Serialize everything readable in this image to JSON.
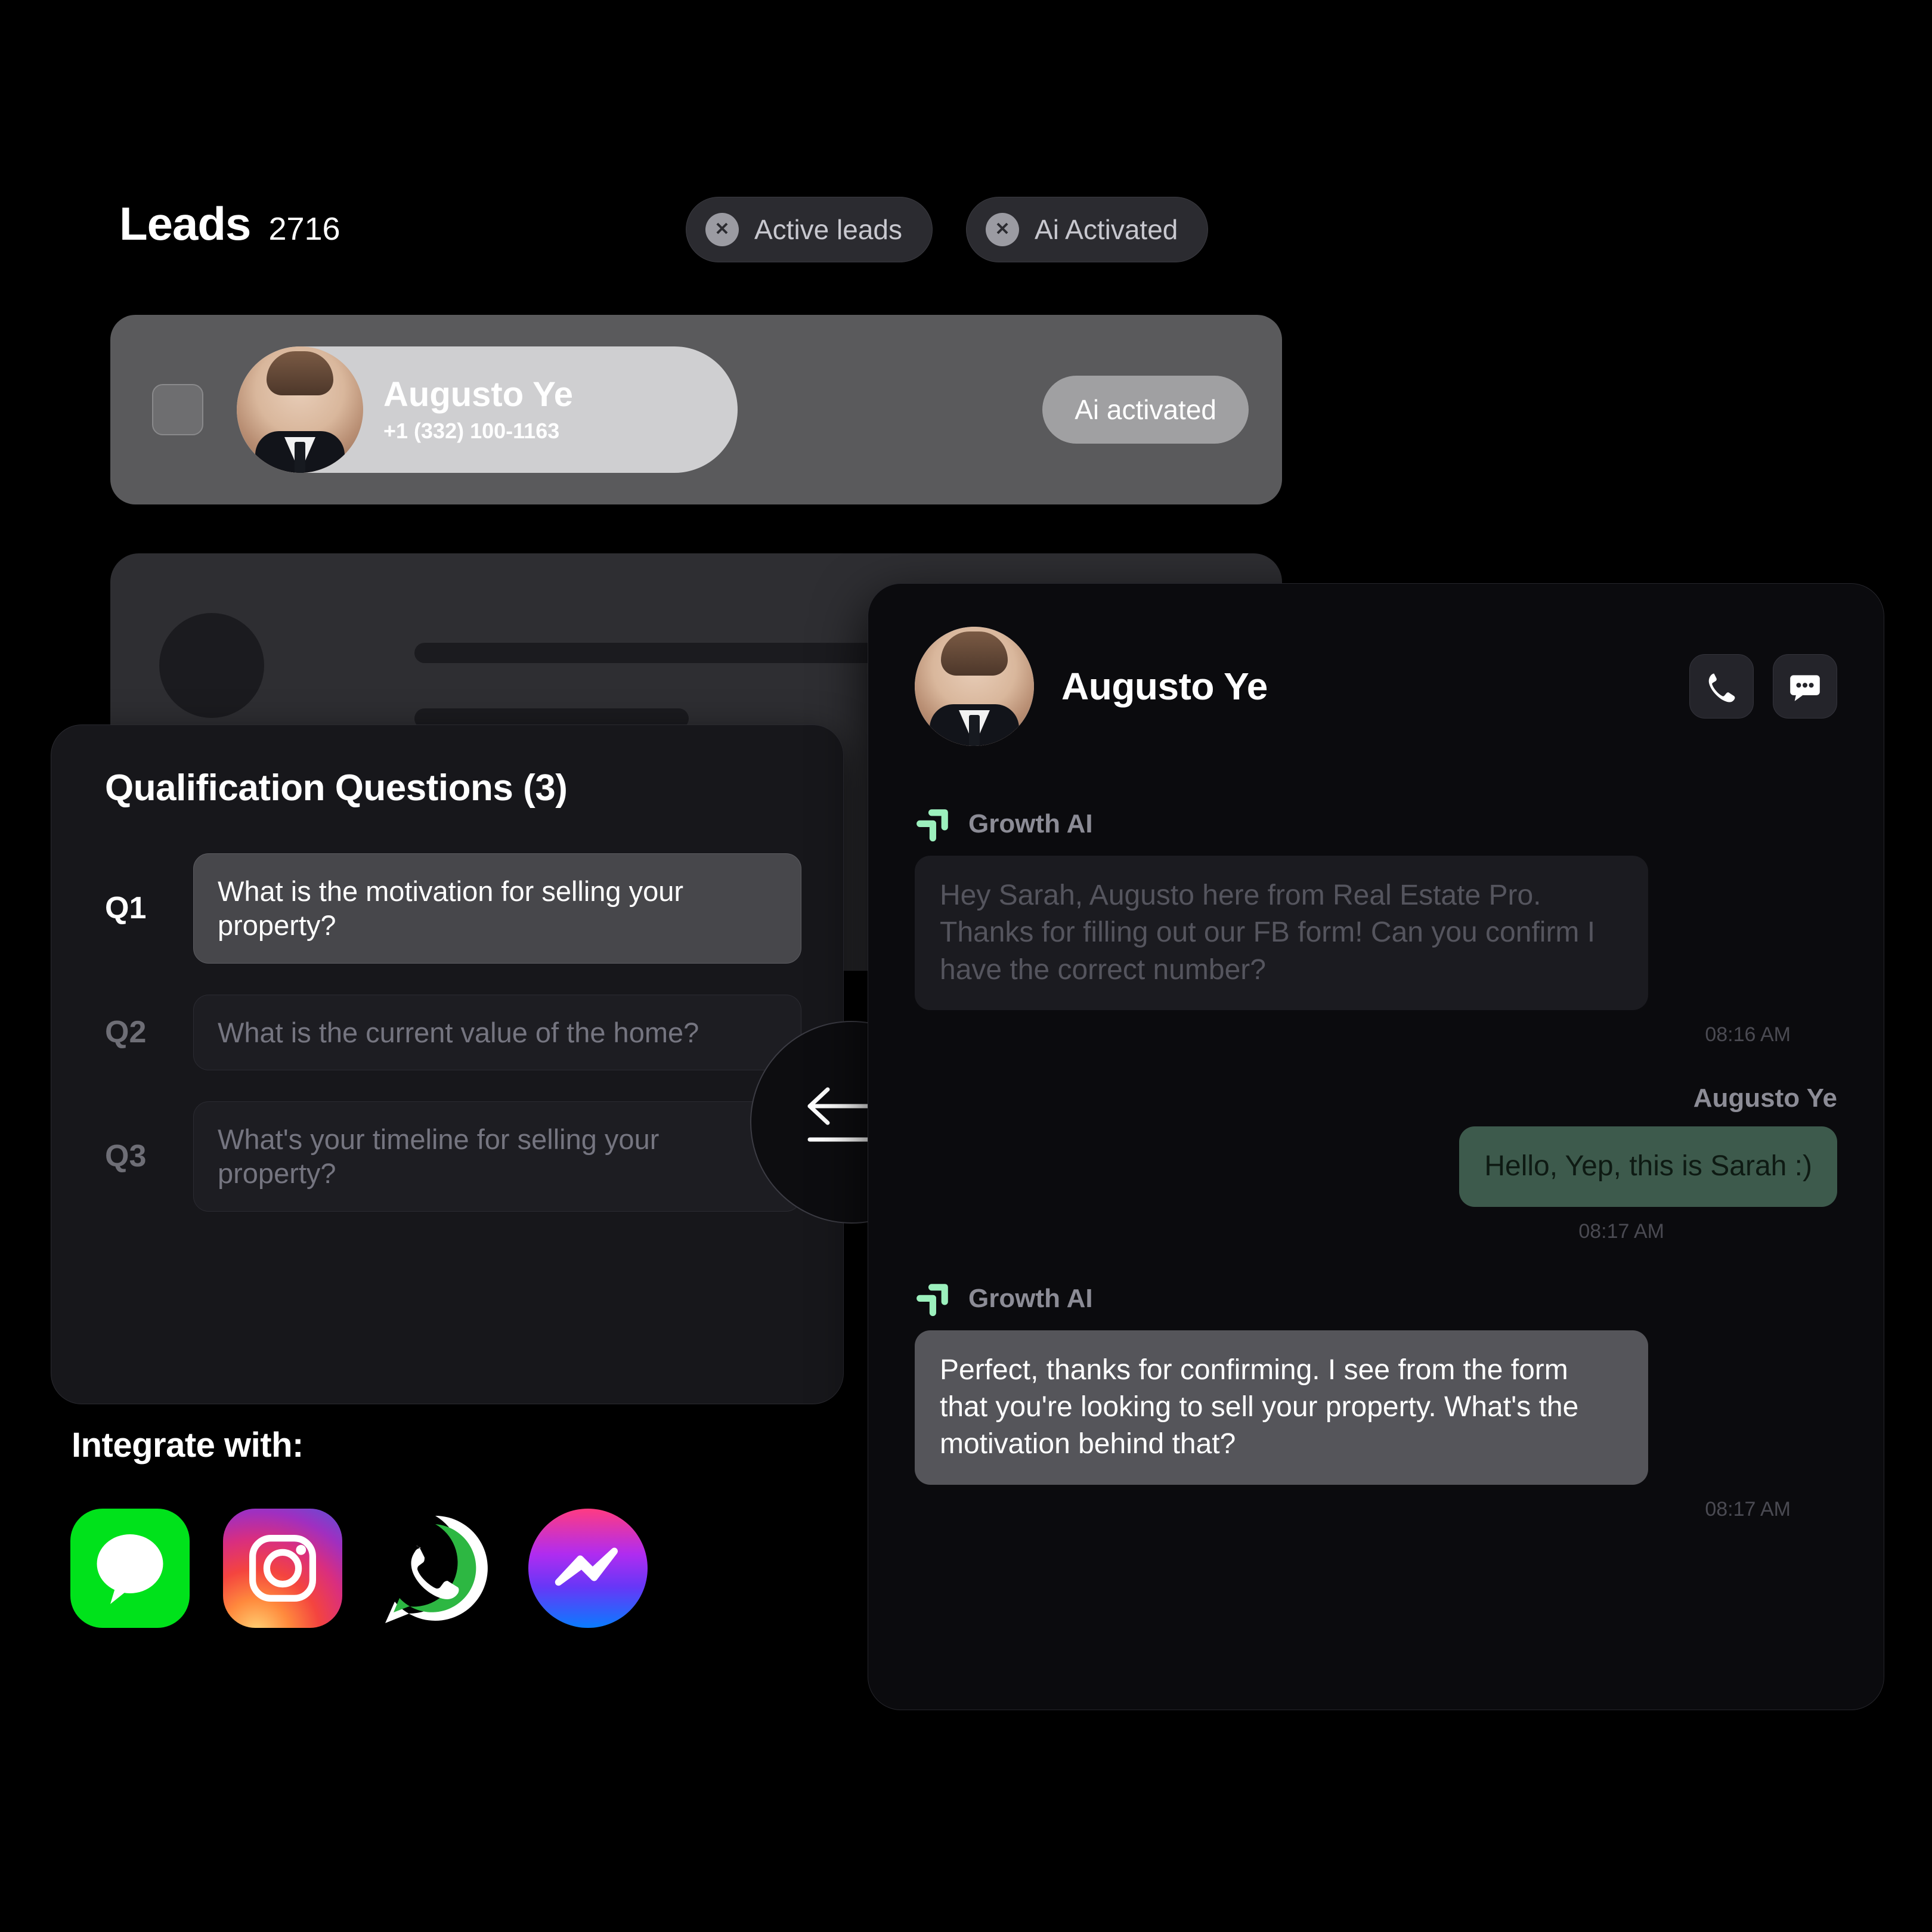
{
  "header": {
    "title": "Leads",
    "count": "2716"
  },
  "filters": [
    {
      "label": "Active leads",
      "icon": "close-icon",
      "remove": "✕"
    },
    {
      "label": "Ai Activated",
      "icon": "close-icon",
      "remove": "✕"
    }
  ],
  "lead_row": {
    "name": "Augusto Ye",
    "phone": "+1 (332) 100-1163",
    "status_badge": "Ai activated",
    "checkbox_checked": false
  },
  "qualification": {
    "title": "Qualification Questions (3)",
    "questions": [
      {
        "key": "Q1",
        "text": "What is the motivation for selling your property?",
        "state": "active"
      },
      {
        "key": "Q2",
        "text": "What is the current value of the home?",
        "state": "muted"
      },
      {
        "key": "Q3",
        "text": "What's your timeline for selling your property?",
        "state": "muted"
      }
    ]
  },
  "swap": {
    "icon": "swap-horizontal-icon"
  },
  "integrations": {
    "label": "Integrate with:",
    "items": [
      {
        "name": "imessage-icon",
        "color": "#00E21B"
      },
      {
        "name": "instagram-icon",
        "color": "#D92E7F"
      },
      {
        "name": "whatsapp-icon",
        "color": "#2DB742"
      },
      {
        "name": "messenger-icon",
        "color": "#6637F7"
      }
    ]
  },
  "chat": {
    "contact_name": "Augusto Ye",
    "actions": [
      {
        "name": "call-button",
        "icon": "phone-icon"
      },
      {
        "name": "message-button",
        "icon": "chat-bubble-icon"
      }
    ],
    "messages": [
      {
        "sender": "Growth AI",
        "side": "left",
        "style": "ai-dim",
        "text": "Hey Sarah, Augusto here from Real Estate Pro. Thanks for filling out our FB form! Can you confirm I have the correct number?",
        "time": "08:16 AM"
      },
      {
        "sender": "Augusto Ye",
        "side": "right",
        "style": "user",
        "text": "Hello, Yep, this is Sarah :)",
        "time": "08:17 AM"
      },
      {
        "sender": "Growth AI",
        "side": "left",
        "style": "ai-bright",
        "text": "Perfect, thanks for confirming. I see from the form that you're looking to sell your property. What's the motivation behind that?",
        "time": "08:17 AM"
      }
    ]
  },
  "colors": {
    "background": "#000000",
    "accent_green": "#9CF0BD",
    "user_bubble": "#3D5A4C",
    "panel": "#0B0B0E"
  }
}
